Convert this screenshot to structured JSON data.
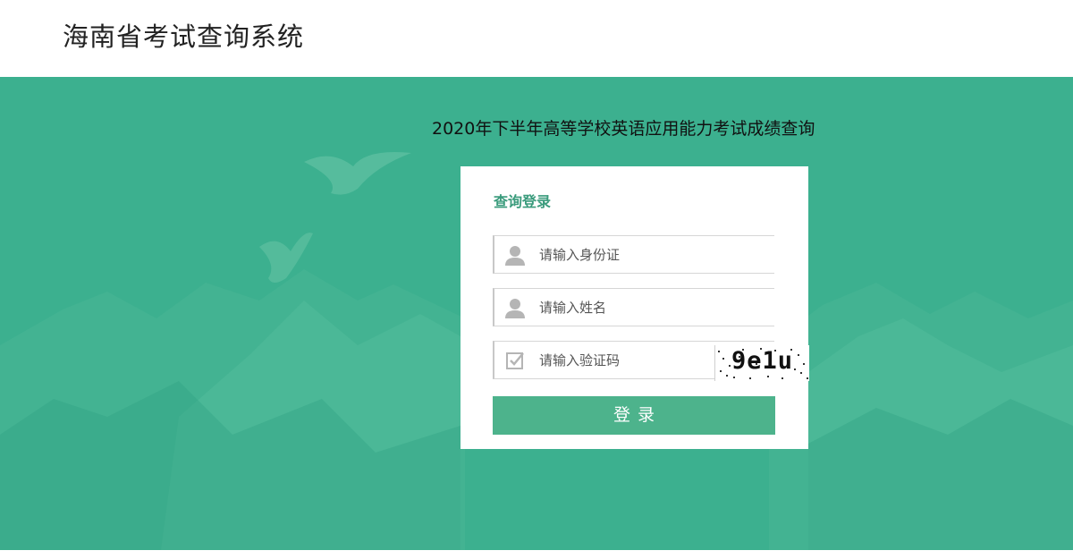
{
  "header": {
    "site_title": "海南省考试查询系统"
  },
  "banner": {
    "exam_title": "2020年下半年高等学校英语应用能力考试成绩查询"
  },
  "login_card": {
    "title": "查询登录",
    "id_field": {
      "placeholder": "请输入身份证",
      "value": "",
      "icon": "user-icon"
    },
    "name_field": {
      "placeholder": "请输入姓名",
      "value": "",
      "icon": "user-icon"
    },
    "captcha_field": {
      "placeholder": "请输入验证码",
      "value": "",
      "icon": "checkbox-icon"
    },
    "captcha_text": "9e1u",
    "login_label": "登录"
  },
  "colors": {
    "banner_bg": "#3cb08f",
    "accent": "#3a9b7c",
    "button": "#4db38c"
  }
}
